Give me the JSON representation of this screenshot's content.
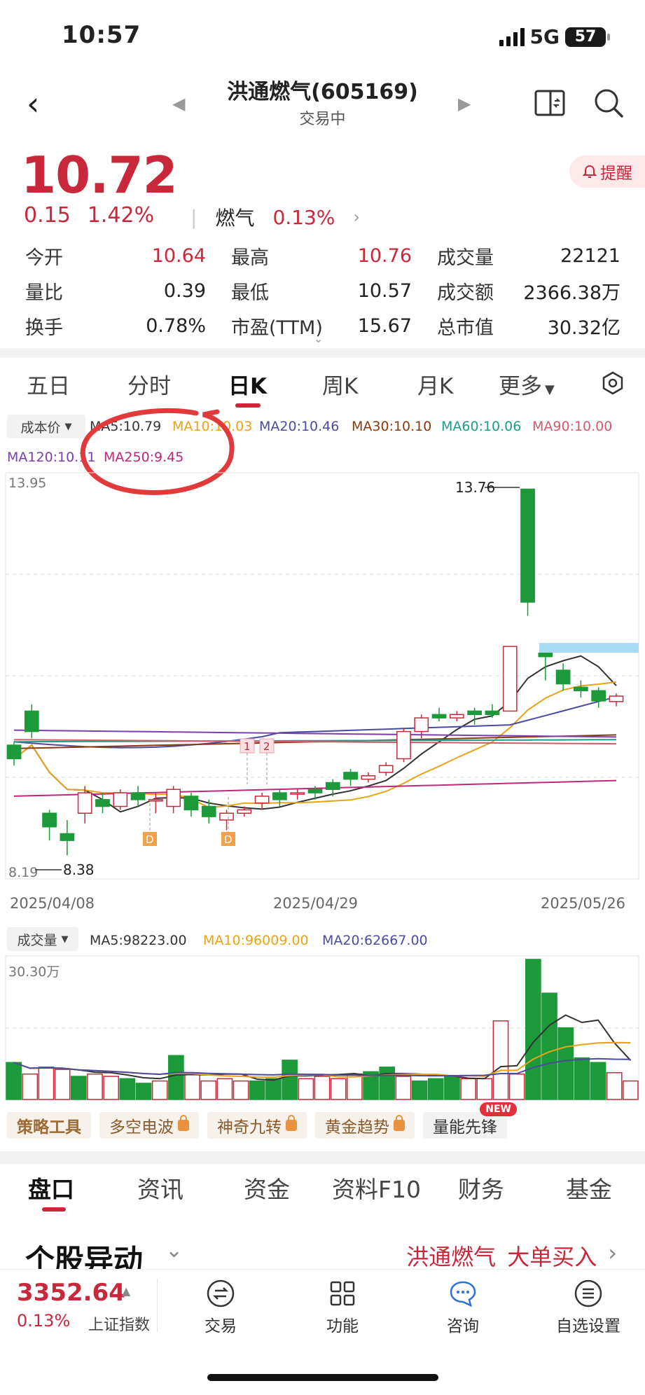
{
  "status": {
    "time": "10:57",
    "network": "5G",
    "battery": "57"
  },
  "header": {
    "title": "洪通燃气(605169)",
    "subtitle": "交易中"
  },
  "quote": {
    "price": "10.72",
    "change": "0.15",
    "change_pct": "1.42%",
    "sector": "燃气",
    "sector_pct": "0.13%",
    "alert_label": "提醒"
  },
  "stats": [
    [
      {
        "label": "今开",
        "value": "10.64"
      },
      {
        "label": "最高",
        "value": "10.76"
      },
      {
        "label": "成交量",
        "value": "22121"
      }
    ],
    [
      {
        "label": "量比",
        "value": "0.39"
      },
      {
        "label": "最低",
        "value": "10.57"
      },
      {
        "label": "成交额",
        "value": "2366.38万"
      }
    ],
    [
      {
        "label": "换手",
        "value": "0.78%"
      },
      {
        "label": "市盈(TTM)",
        "value": "15.67"
      },
      {
        "label": "总市值",
        "value": "30.32亿"
      }
    ]
  ],
  "period_tabs": [
    "五日",
    "分时",
    "日K",
    "周K",
    "月K",
    "更多"
  ],
  "active_period": "日K",
  "ma": {
    "cost_label": "成本价",
    "ma5": "MA5:10.79",
    "ma10": "MA10:10.03",
    "ma20": "MA20:10.46",
    "ma30": "MA30:10.10",
    "ma60": "MA60:10.06",
    "ma90": "MA90:10.00",
    "ma120": "MA120:10.11",
    "ma250": "MA250:9.45"
  },
  "colors": {
    "up": "#c8283a",
    "down": "#1c9a3a",
    "ma5": "#333333",
    "ma10": "#e8a317",
    "ma20": "#4b4ba0",
    "ma30": "#8b3a10",
    "ma60": "#1a9e86",
    "ma90": "#d45a6a",
    "ma120": "#7a3fb0",
    "ma250": "#c0267a",
    "annotation": "#e23a3a"
  },
  "chart_data": {
    "type": "candlestick",
    "y_top_label": "13.95",
    "y_bottom_label": "8.19",
    "high_marker": "13.76",
    "low_marker": "8.38",
    "dates": [
      "2025/04/08",
      "2025/04/29",
      "2025/05/26"
    ],
    "markers": [
      "1",
      "2",
      "D",
      "D"
    ],
    "candles": [
      {
        "o": 10.0,
        "c": 9.8,
        "h": 10.05,
        "l": 9.7
      },
      {
        "o": 10.5,
        "c": 10.2,
        "h": 10.6,
        "l": 10.1
      },
      {
        "o": 9.0,
        "c": 8.8,
        "h": 9.05,
        "l": 8.6
      },
      {
        "o": 8.7,
        "c": 8.6,
        "h": 8.9,
        "l": 8.38
      },
      {
        "o": 9.0,
        "c": 9.3,
        "h": 9.4,
        "l": 8.85
      },
      {
        "o": 9.2,
        "c": 9.1,
        "h": 9.3,
        "l": 9.0
      },
      {
        "o": 9.1,
        "c": 9.3,
        "h": 9.35,
        "l": 9.05
      },
      {
        "o": 9.3,
        "c": 9.2,
        "h": 9.4,
        "l": 9.1
      },
      {
        "o": 9.2,
        "c": 9.2,
        "h": 9.3,
        "l": 9.0
      },
      {
        "o": 9.1,
        "c": 9.35,
        "h": 9.4,
        "l": 9.0
      },
      {
        "o": 9.25,
        "c": 9.05,
        "h": 9.3,
        "l": 8.95
      },
      {
        "o": 9.1,
        "c": 8.95,
        "h": 9.2,
        "l": 8.85
      },
      {
        "o": 8.9,
        "c": 9.0,
        "h": 9.05,
        "l": 8.75
      },
      {
        "o": 9.0,
        "c": 9.05,
        "h": 9.1,
        "l": 8.95
      },
      {
        "o": 9.15,
        "c": 9.25,
        "h": 9.3,
        "l": 9.05
      },
      {
        "o": 9.3,
        "c": 9.2,
        "h": 9.35,
        "l": 9.1
      },
      {
        "o": 9.3,
        "c": 9.3,
        "h": 9.35,
        "l": 9.2
      },
      {
        "o": 9.35,
        "c": 9.3,
        "h": 9.4,
        "l": 9.2
      },
      {
        "o": 9.45,
        "c": 9.35,
        "h": 9.5,
        "l": 9.25
      },
      {
        "o": 9.6,
        "c": 9.5,
        "h": 9.65,
        "l": 9.4
      },
      {
        "o": 9.5,
        "c": 9.55,
        "h": 9.6,
        "l": 9.45
      },
      {
        "o": 9.6,
        "c": 9.7,
        "h": 9.75,
        "l": 9.55
      },
      {
        "o": 9.8,
        "c": 10.2,
        "h": 10.25,
        "l": 9.75
      },
      {
        "o": 10.2,
        "c": 10.4,
        "h": 10.45,
        "l": 10.1
      },
      {
        "o": 10.45,
        "c": 10.4,
        "h": 10.55,
        "l": 10.35
      },
      {
        "o": 10.4,
        "c": 10.45,
        "h": 10.5,
        "l": 10.35
      },
      {
        "o": 10.5,
        "c": 10.45,
        "h": 10.55,
        "l": 10.3
      },
      {
        "o": 10.5,
        "c": 10.45,
        "h": 10.6,
        "l": 10.4
      },
      {
        "o": 10.5,
        "c": 11.45,
        "h": 11.45,
        "l": 10.5
      },
      {
        "o": 13.76,
        "c": 12.1,
        "h": 13.76,
        "l": 11.9
      },
      {
        "o": 11.35,
        "c": 11.3,
        "h": 11.5,
        "l": 10.95
      },
      {
        "o": 11.1,
        "c": 10.9,
        "h": 11.2,
        "l": 10.8
      },
      {
        "o": 10.85,
        "c": 10.8,
        "h": 10.95,
        "l": 10.7
      },
      {
        "o": 10.8,
        "c": 10.65,
        "h": 10.85,
        "l": 10.55
      },
      {
        "o": 10.64,
        "c": 10.72,
        "h": 10.76,
        "l": 10.57
      }
    ]
  },
  "volume": {
    "label": "成交量",
    "ma5": "MA5:98223.00",
    "ma10": "MA10:96009.00",
    "ma20": "MA20:62667.00",
    "top_label": "30.30万",
    "values": [
      8.0,
      5.5,
      7.0,
      6.5,
      5.0,
      5.5,
      5.0,
      4.5,
      3.5,
      4.0,
      9.5,
      5.5,
      4.0,
      4.5,
      4.0,
      4.0,
      4.5,
      8.5,
      4.5,
      5.0,
      4.5,
      5.5,
      6.0,
      7.0,
      5.0,
      4.0,
      4.5,
      5.0,
      4.5,
      4.5,
      17.0,
      5.5,
      30.3,
      23.0,
      15.5,
      9.0,
      8.0,
      5.8,
      4.0
    ],
    "up": [
      false,
      true,
      true,
      true,
      false,
      true,
      true,
      false,
      false,
      true,
      false,
      true,
      true,
      true,
      true,
      false,
      false,
      false,
      true,
      true,
      true,
      true,
      false,
      false,
      true,
      false,
      false,
      false,
      true,
      true,
      true,
      true,
      false,
      false,
      false,
      false,
      false,
      true,
      true
    ]
  },
  "tools": [
    "策略工具",
    "多空电波",
    "神奇九转",
    "黄金趋势",
    "量能先锋"
  ],
  "new_badge": "NEW",
  "bottom_tabs": [
    "盘口",
    "资讯",
    "资金",
    "资料F10",
    "财务",
    "基金"
  ],
  "section": {
    "title": "个股异动",
    "news_stock": "洪通燃气",
    "news_action": "大单买入"
  },
  "index": {
    "value": "3352.64",
    "pct": "0.13%",
    "name": "上证指数"
  },
  "nav": [
    "交易",
    "功能",
    "咨询",
    "自选设置"
  ]
}
